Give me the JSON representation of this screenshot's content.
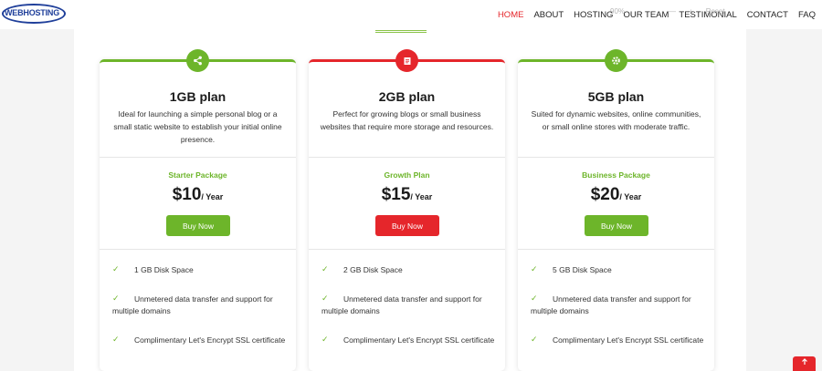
{
  "brand": {
    "logo_text": "WEBHOSTING"
  },
  "nav": {
    "items": [
      {
        "label": "HOME",
        "active": true
      },
      {
        "label": "ABOUT"
      },
      {
        "label": "HOSTING"
      },
      {
        "label": "OUR TEAM"
      },
      {
        "label": "TESTIMONIAL"
      },
      {
        "label": "CONTACT"
      },
      {
        "label": "FAQ"
      }
    ]
  },
  "zoom_overlay": {
    "zoom": "90%",
    "minus": "—",
    "plus": "+",
    "reset": "Reset"
  },
  "plans": [
    {
      "icon": "share-icon",
      "accent": "#6db52a",
      "title": "1GB plan",
      "description": "Ideal for launching a simple personal blog or a small static website to establish your initial online presence.",
      "package": "Starter Package",
      "price": "$10",
      "period": "/ Year",
      "button": "Buy Now",
      "features": [
        "1 GB Disk Space",
        "Unmetered data transfer and support for multiple domains",
        "Complimentary Let's Encrypt SSL certificate"
      ]
    },
    {
      "icon": "document-icon",
      "accent": "#e5262b",
      "title": "2GB plan",
      "description": "Perfect for growing blogs or small business websites that require more storage and resources.",
      "package": "Growth Plan",
      "price": "$15",
      "period": "/ Year",
      "button": "Buy Now",
      "features": [
        "2 GB Disk Space",
        "Unmetered data transfer and support for multiple domains",
        "Complimentary Let's Encrypt SSL certificate"
      ]
    },
    {
      "icon": "gear-icon",
      "accent": "#6db52a",
      "title": "5GB plan",
      "description": "Suited for dynamic websites, online communities, or small online stores with moderate traffic.",
      "package": "Business Package",
      "price": "$20",
      "period": "/ Year",
      "button": "Buy Now",
      "features": [
        "5 GB Disk Space",
        "Unmetered data transfer and support for multiple domains",
        "Complimentary Let's Encrypt SSL certificate"
      ]
    }
  ],
  "scroll_top": {
    "icon": "arrow-up-icon"
  }
}
